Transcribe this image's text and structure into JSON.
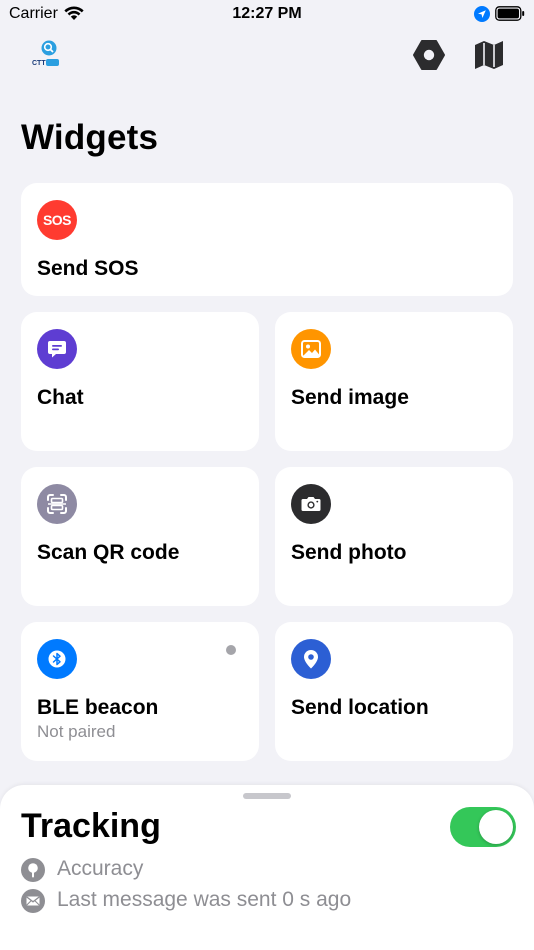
{
  "status_bar": {
    "carrier": "Carrier",
    "time": "12:27 PM"
  },
  "logo": {
    "text": "CTT"
  },
  "page_title": "Widgets",
  "widgets": [
    {
      "id": "sos",
      "label": "Send SOS",
      "icon_text": "SOS",
      "icon": "sos-icon",
      "color": "#ff3b30"
    },
    {
      "id": "chat",
      "label": "Chat",
      "icon": "chat-bubble-icon",
      "color": "#5e3dd2"
    },
    {
      "id": "image",
      "label": "Send image",
      "icon": "image-icon",
      "color": "#ff9500"
    },
    {
      "id": "qr",
      "label": "Scan QR code",
      "icon": "qr-scan-icon",
      "color": "#8e8aa3"
    },
    {
      "id": "photo",
      "label": "Send photo",
      "icon": "camera-icon",
      "color": "#2c2c2e"
    },
    {
      "id": "ble",
      "label": "BLE beacon",
      "sublabel": "Not paired",
      "icon": "bluetooth-icon",
      "color": "#007aff"
    },
    {
      "id": "location",
      "label": "Send location",
      "icon": "location-pin-icon",
      "color": "#2c5fd4"
    }
  ],
  "tracking": {
    "title": "Tracking",
    "enabled": true,
    "accent": "#34c759",
    "accuracy_label": "Accuracy",
    "last_message": "Last message was sent 0 s ago"
  }
}
